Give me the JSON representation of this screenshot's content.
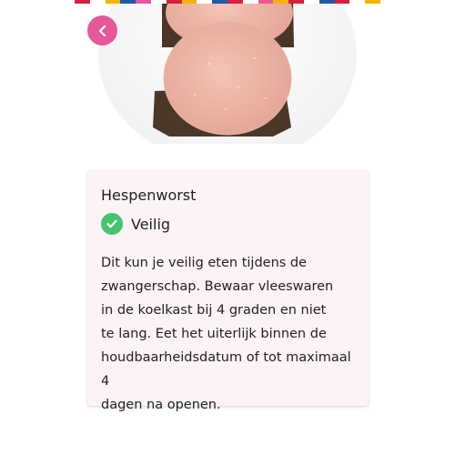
{
  "colors": {
    "accent": "#e8579a",
    "safe": "#46c36f",
    "card_background": "#fdf2f4",
    "flag_strip": [
      "#d4213d",
      "#ffffff",
      "#f2b400",
      "#1e5aa8",
      "#e8579a",
      "#ffffff",
      "#d4213d",
      "#f2b400",
      "#ffffff",
      "#1e5aa8",
      "#d4213d",
      "#ffffff",
      "#e8579a",
      "#f2b400",
      "#d4213d",
      "#ffffff",
      "#1e5aa8",
      "#d4213d",
      "#ffffff",
      "#f2b400"
    ]
  },
  "header": {
    "back_icon": "chevron-left-icon",
    "image": "hespenworst-on-bread-photo"
  },
  "item": {
    "title": "Hespenworst",
    "status_icon": "check-circle-icon",
    "status": "Veilig",
    "description": "Dit kun je veilig eten tijdens de\nzwangerschap. Bewaar vleeswaren\nin de koelkast bij 4 graden en niet\nte lang. Eet het uiterlijk binnen de\nhoudbaarheidsdatum of tot maximaal 4\ndagen na openen."
  }
}
